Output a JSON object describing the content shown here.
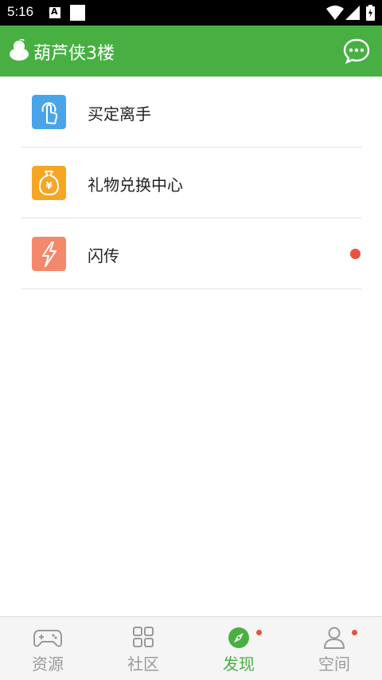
{
  "status_bar": {
    "time": "5:16",
    "notification_icon": "A",
    "icons": [
      "wifi-icon",
      "signal-icon",
      "battery-icon"
    ]
  },
  "app_bar": {
    "title": "葫芦侠3楼",
    "logo_icon": "gourd-logo-icon",
    "action_icon": "chat-bubble-icon"
  },
  "discover_list": [
    {
      "label": "买定离手",
      "icon": "touch-hand-icon",
      "icon_color": "#4aa4e8",
      "has_dot": false
    },
    {
      "label": "礼物兑换中心",
      "icon": "money-bag-icon",
      "icon_color": "#f6a623",
      "has_dot": false
    },
    {
      "label": "闪传",
      "icon": "lightning-icon",
      "icon_color": "#f4886b",
      "has_dot": true
    }
  ],
  "bottom_nav": [
    {
      "label": "资源",
      "icon": "gamepad-icon",
      "active": false,
      "has_dot": false
    },
    {
      "label": "社区",
      "icon": "grid-icon",
      "active": false,
      "has_dot": false
    },
    {
      "label": "发现",
      "icon": "compass-icon",
      "active": true,
      "has_dot": true
    },
    {
      "label": "空间",
      "icon": "person-icon",
      "active": false,
      "has_dot": true
    }
  ],
  "colors": {
    "brand_green": "#48b043",
    "badge_red": "#e8523f",
    "inactive_gray": "#9a9a9a"
  }
}
